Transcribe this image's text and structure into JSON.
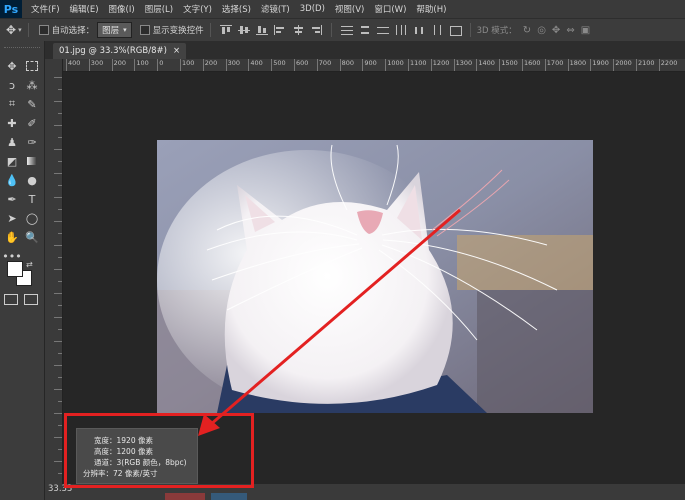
{
  "app": {
    "logo": "Ps"
  },
  "menu": [
    "文件(F)",
    "编辑(E)",
    "图像(I)",
    "图层(L)",
    "文字(Y)",
    "选择(S)",
    "滤镜(T)",
    "3D(D)",
    "视图(V)",
    "窗口(W)",
    "帮助(H)"
  ],
  "options": {
    "auto_select_label": "自动选择：",
    "auto_select_value": "图层",
    "show_transform_label": "显示变换控件",
    "mode_label": "3D 模式："
  },
  "document": {
    "tab_title": "01.jpg @ 33.3%(RGB/8#)",
    "close_glyph": "×"
  },
  "ruler": {
    "h_ticks": [
      "400",
      "300",
      "200",
      "100",
      "0",
      "100",
      "200",
      "300",
      "400",
      "500",
      "600",
      "700",
      "800",
      "900",
      "1000",
      "1100",
      "1200",
      "1300",
      "1400",
      "1500",
      "1600",
      "1700",
      "1800",
      "1900",
      "2000",
      "2100",
      "2200"
    ]
  },
  "status": {
    "zoom": "33.33"
  },
  "info_popup": {
    "width": "宽度：1920 像素",
    "height": "高度：1200 像素",
    "channels": "通道：3(RGB 颜色，8bpc)",
    "resolution": "分辨率：72 像素/英寸"
  },
  "colors": {
    "annotation_red": "#e32121",
    "ps_blue": "#31a8ff"
  }
}
